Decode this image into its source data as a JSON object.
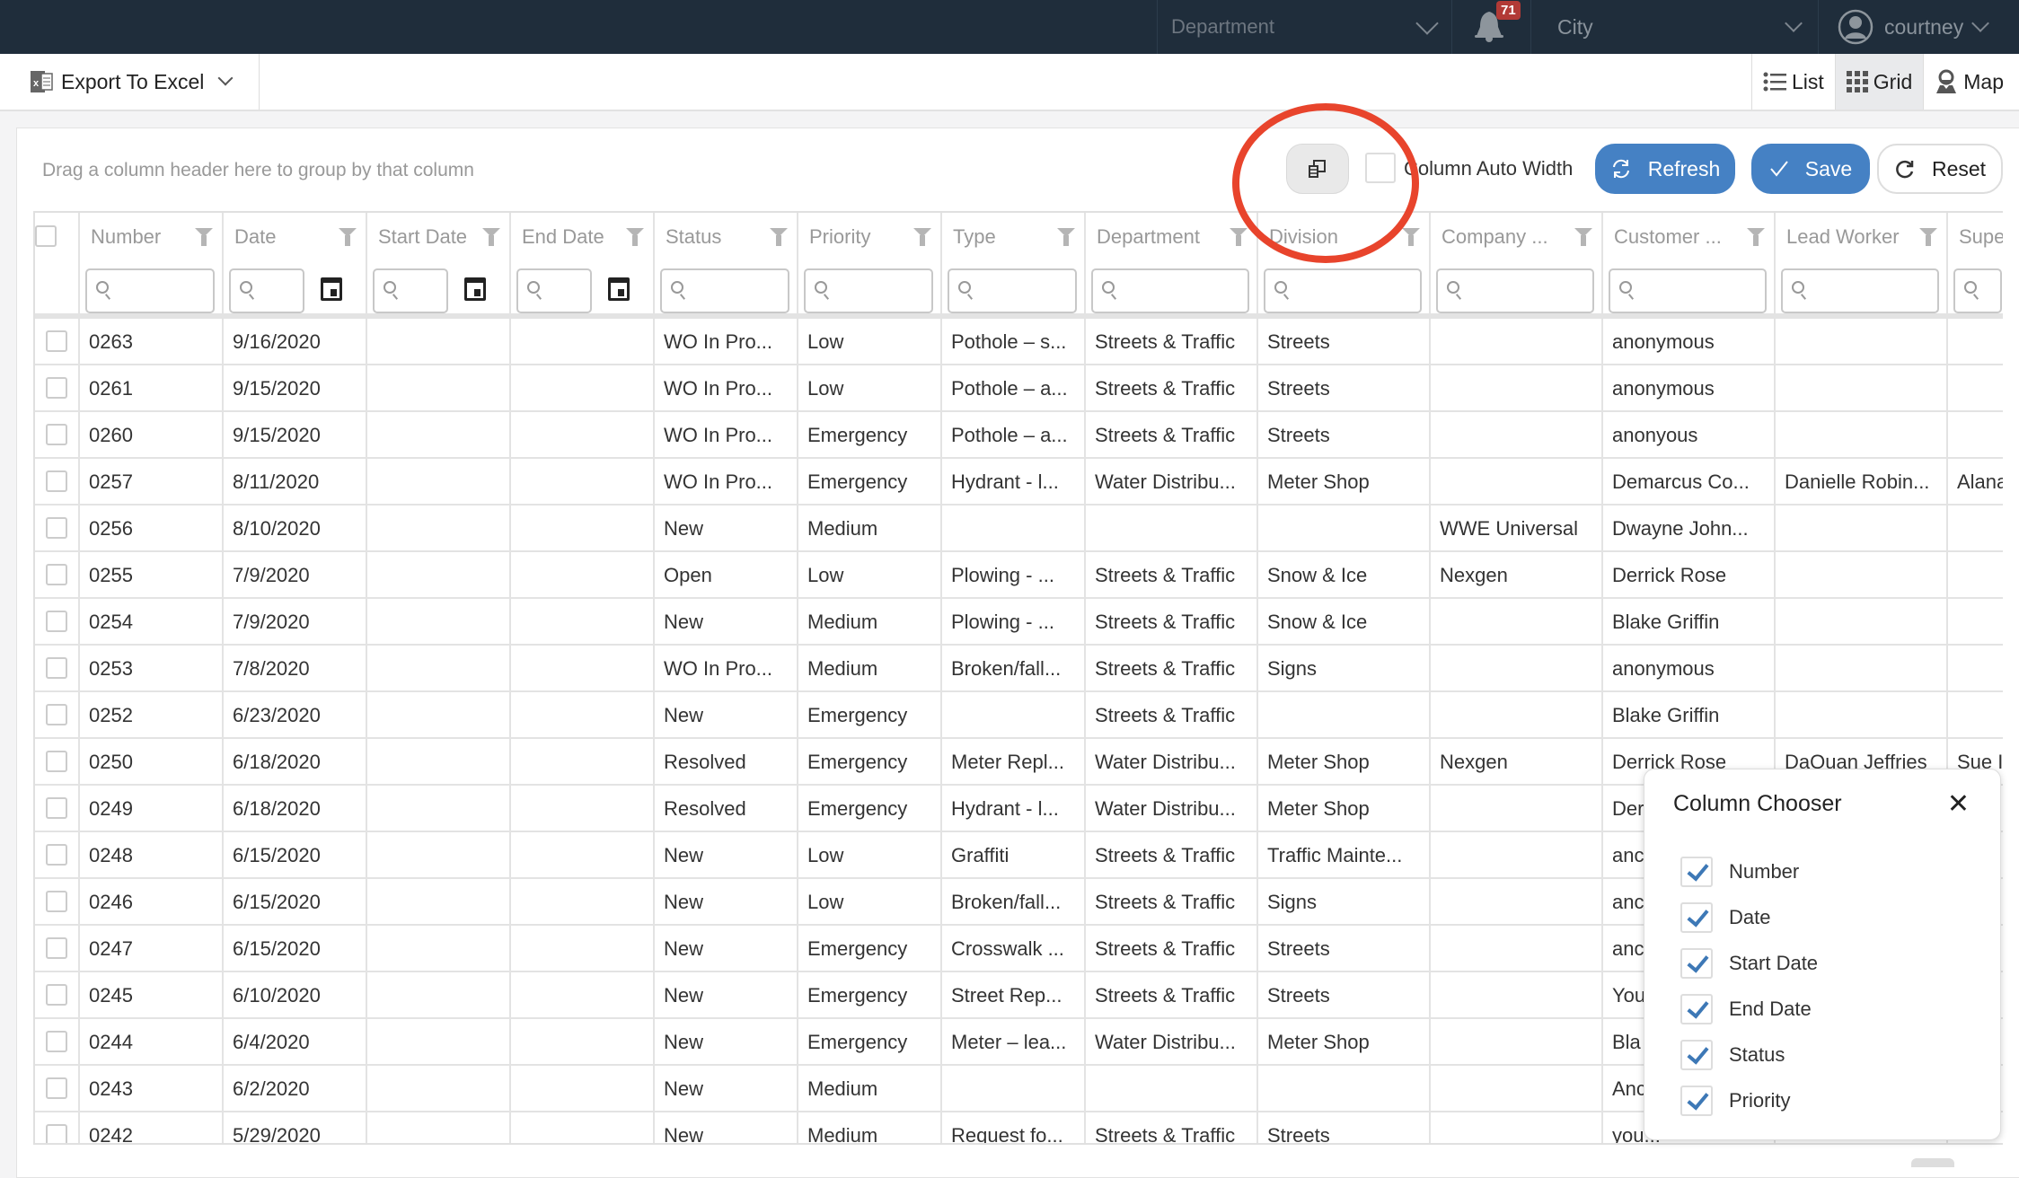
{
  "topbar": {
    "department_placeholder": "Department",
    "notification_count": "71",
    "city_placeholder": "City",
    "username": "courtney"
  },
  "toolbar": {
    "export_label": "Export To Excel",
    "views": [
      {
        "label": "List",
        "icon": "list-icon",
        "active": false
      },
      {
        "label": "Grid",
        "icon": "grid-icon",
        "active": true
      },
      {
        "label": "Map",
        "icon": "map-pin-icon",
        "active": false
      }
    ]
  },
  "grid_toolbar": {
    "group_panel_text": "Drag a column header here to group by that column",
    "column_auto_width_label": "Column Auto Width",
    "column_auto_width_checked": false,
    "refresh_label": "Refresh",
    "save_label": "Save",
    "reset_label": "Reset"
  },
  "columns": [
    {
      "key": "number",
      "label": "Number",
      "date_filter": false
    },
    {
      "key": "date",
      "label": "Date",
      "date_filter": true
    },
    {
      "key": "start_date",
      "label": "Start Date",
      "date_filter": true
    },
    {
      "key": "end_date",
      "label": "End Date",
      "date_filter": true
    },
    {
      "key": "status",
      "label": "Status",
      "date_filter": false
    },
    {
      "key": "priority",
      "label": "Priority",
      "date_filter": false
    },
    {
      "key": "type",
      "label": "Type",
      "date_filter": false
    },
    {
      "key": "department",
      "label": "Department",
      "date_filter": false
    },
    {
      "key": "division",
      "label": "Division",
      "date_filter": false
    },
    {
      "key": "company",
      "label": "Company ...",
      "date_filter": false
    },
    {
      "key": "customer",
      "label": "Customer ...",
      "date_filter": false
    },
    {
      "key": "lead_worker",
      "label": "Lead Worker",
      "date_filter": false
    },
    {
      "key": "supervisor",
      "label": "Supe",
      "date_filter": false
    }
  ],
  "rows": [
    [
      "0263",
      "9/16/2020",
      "",
      "",
      "WO In Pro...",
      "Low",
      "Pothole – s...",
      "Streets & Traffic",
      "Streets",
      "",
      "anonymous",
      "",
      ""
    ],
    [
      "0261",
      "9/15/2020",
      "",
      "",
      "WO In Pro...",
      "Low",
      "Pothole – a...",
      "Streets & Traffic",
      "Streets",
      "",
      "anonymous",
      "",
      ""
    ],
    [
      "0260",
      "9/15/2020",
      "",
      "",
      "WO In Pro...",
      "Emergency",
      "Pothole – a...",
      "Streets & Traffic",
      "Streets",
      "",
      "anonyous",
      "",
      ""
    ],
    [
      "0257",
      "8/11/2020",
      "",
      "",
      "WO In Pro...",
      "Emergency",
      "Hydrant - l...",
      "Water Distribu...",
      "Meter Shop",
      "",
      "Demarcus Co...",
      "Danielle Robin...",
      "Alana"
    ],
    [
      "0256",
      "8/10/2020",
      "",
      "",
      "New",
      "Medium",
      "",
      "",
      "",
      "WWE Universal",
      "Dwayne John...",
      "",
      ""
    ],
    [
      "0255",
      "7/9/2020",
      "",
      "",
      "Open",
      "Low",
      "Plowing - ...",
      "Streets & Traffic",
      "Snow & Ice",
      "Nexgen",
      "Derrick Rose",
      "",
      ""
    ],
    [
      "0254",
      "7/9/2020",
      "",
      "",
      "New",
      "Medium",
      "Plowing - ...",
      "Streets & Traffic",
      "Snow & Ice",
      "",
      "Blake Griffin",
      "",
      ""
    ],
    [
      "0253",
      "7/8/2020",
      "",
      "",
      "WO In Pro...",
      "Medium",
      "Broken/fall...",
      "Streets & Traffic",
      "Signs",
      "",
      "anonymous",
      "",
      ""
    ],
    [
      "0252",
      "6/23/2020",
      "",
      "",
      "New",
      "Emergency",
      "",
      "Streets & Traffic",
      "",
      "",
      "Blake Griffin",
      "",
      ""
    ],
    [
      "0250",
      "6/18/2020",
      "",
      "",
      "Resolved",
      "Emergency",
      "Meter Repl...",
      "Water Distribu...",
      "Meter Shop",
      "Nexgen",
      "Derrick Rose",
      "DaQuan Jeffries",
      "Sue I"
    ],
    [
      "0249",
      "6/18/2020",
      "",
      "",
      "Resolved",
      "Emergency",
      "Hydrant - l...",
      "Water Distribu...",
      "Meter Shop",
      "",
      "Der",
      "",
      ""
    ],
    [
      "0248",
      "6/15/2020",
      "",
      "",
      "New",
      "Low",
      "Graffiti",
      "Streets & Traffic",
      "Traffic Mainte...",
      "",
      "anc",
      "",
      ""
    ],
    [
      "0246",
      "6/15/2020",
      "",
      "",
      "New",
      "Low",
      "Broken/fall...",
      "Streets & Traffic",
      "Signs",
      "",
      "anc",
      "",
      ""
    ],
    [
      "0247",
      "6/15/2020",
      "",
      "",
      "New",
      "Emergency",
      "Crosswalk ...",
      "Streets & Traffic",
      "Streets",
      "",
      "anc",
      "",
      ""
    ],
    [
      "0245",
      "6/10/2020",
      "",
      "",
      "New",
      "Emergency",
      "Street Rep...",
      "Streets & Traffic",
      "Streets",
      "",
      "You",
      "",
      ""
    ],
    [
      "0244",
      "6/4/2020",
      "",
      "",
      "New",
      "Emergency",
      "Meter – lea...",
      "Water Distribu...",
      "Meter Shop",
      "",
      "Bla",
      "",
      ""
    ],
    [
      "0243",
      "6/2/2020",
      "",
      "",
      "New",
      "Medium",
      "",
      "",
      "",
      "",
      "Anc",
      "",
      ""
    ],
    [
      "0242",
      "5/29/2020",
      "",
      "",
      "New",
      "Medium",
      "Request fo...",
      "Streets & Traffic",
      "Streets",
      "",
      "you...",
      "",
      ""
    ]
  ],
  "column_chooser": {
    "title": "Column Chooser",
    "items": [
      {
        "label": "Number",
        "checked": true
      },
      {
        "label": "Date",
        "checked": true
      },
      {
        "label": "Start Date",
        "checked": true
      },
      {
        "label": "End Date",
        "checked": true
      },
      {
        "label": "Status",
        "checked": true
      },
      {
        "label": "Priority",
        "checked": true
      }
    ]
  },
  "colors": {
    "topbar_bg": "#1f2d3b",
    "primary_button": "#4581c4",
    "badge": "#b23a36",
    "annotation_circle": "#e8442c",
    "checkmark": "#3d78b6"
  }
}
